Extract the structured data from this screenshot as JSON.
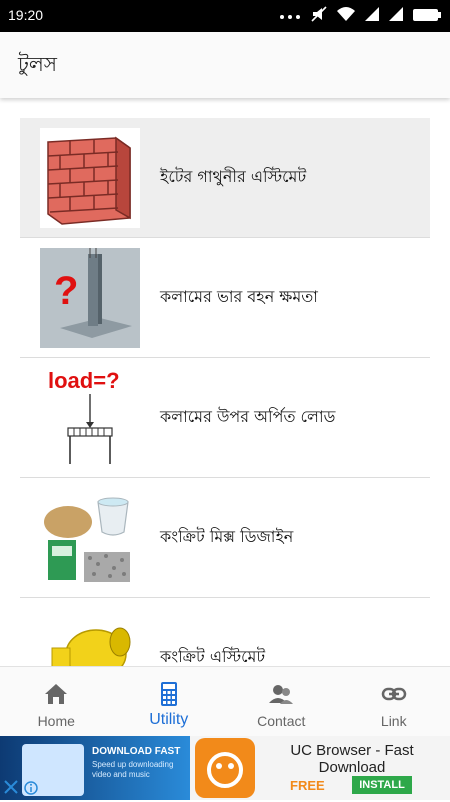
{
  "status_bar": {
    "time": "19:20"
  },
  "toolbar": {
    "title": "টুলস"
  },
  "list": {
    "items": [
      {
        "label": "ইটের গাথুনীর এস্টিমেট",
        "icon": "brick-wall-icon"
      },
      {
        "label": "কলামের ভার বহন ক্ষমতা",
        "icon": "column-question-icon"
      },
      {
        "label": "কলামের উপর অর্পিত লোড",
        "icon": "column-load-icon",
        "thumb_text": "load=?"
      },
      {
        "label": "কংক্রিট মিক্স ডিজাইন",
        "icon": "concrete-materials-icon"
      },
      {
        "label": "কংক্রিট এস্টিমেট",
        "icon": "concrete-mixer-icon"
      }
    ]
  },
  "bottom_nav": {
    "items": [
      {
        "label": "Home",
        "icon": "home-icon"
      },
      {
        "label": "Utility",
        "icon": "calculator-icon",
        "active": true
      },
      {
        "label": "Contact",
        "icon": "contacts-icon"
      },
      {
        "label": "Link",
        "icon": "link-icon"
      }
    ],
    "active_color": "#1e6fd6"
  },
  "ad": {
    "image_title": "DOWNLOAD FAST",
    "image_sub": "Speed up downloading video and music",
    "title": "UC Browser - Fast Download",
    "price": "FREE",
    "install_label": "INSTALL"
  }
}
